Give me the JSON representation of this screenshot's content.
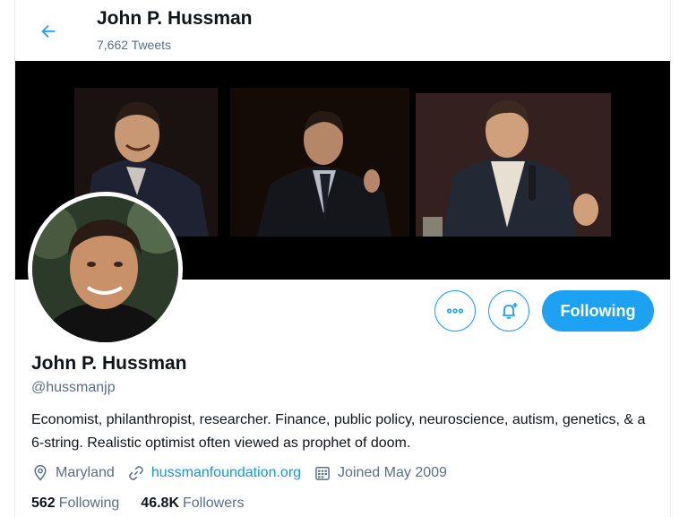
{
  "header": {
    "name": "John P. Hussman",
    "tweet_count": "7,662 Tweets"
  },
  "profile": {
    "name": "John P. Hussman",
    "handle": "@hussmanjp",
    "bio": "Economist, philanthropist, researcher. Finance, public policy, neuroscience, autism, genetics, & a 6-string. Realistic optimist often viewed as prophet of doom.",
    "location": "Maryland",
    "website": "hussmanfoundation.org",
    "joined": "Joined May 2009",
    "following_count": "562",
    "following_label": "Following",
    "followers_count": "46.8K",
    "followers_label": "Followers"
  },
  "actions": {
    "follow_button": "Following"
  },
  "icons": [
    "back-arrow-icon",
    "more-icon",
    "notification-bell-icon",
    "location-icon",
    "link-icon",
    "calendar-icon"
  ],
  "colors": {
    "accent": "#1da1f2",
    "link": "#1b95e0",
    "secondary_text": "#5b7083"
  }
}
